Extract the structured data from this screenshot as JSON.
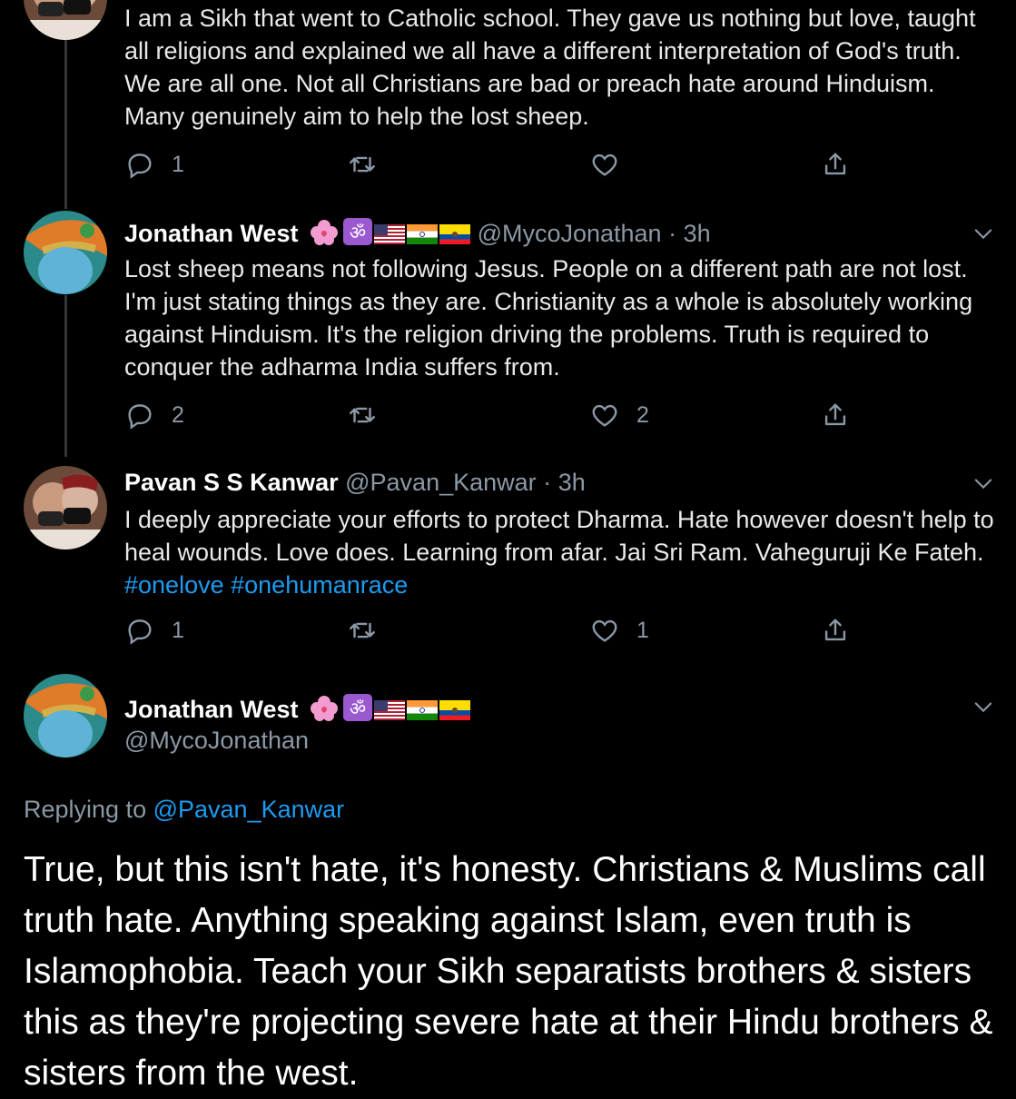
{
  "tweets": [
    {
      "text": "I am a Sikh that went to Catholic school. They gave us nothing but love, taught all religions and explained we all have a different interpretation of God's truth. We are all one. Not all Christians are bad or preach hate around Hinduism. Many genuinely aim to help the lost sheep.",
      "reply_count": "1",
      "retweet_count": "",
      "like_count": ""
    },
    {
      "name": "Jonathan West",
      "handle": "@MycoJonathan",
      "dot": "·",
      "time": "3h",
      "text": "Lost sheep means not following Jesus. People on a different path are not lost. I'm just stating things as they are. Christianity as a whole is absolutely working against Hinduism. It's the religion driving the problems. Truth is required to conquer the adharma India suffers from.",
      "reply_count": "2",
      "retweet_count": "",
      "like_count": "2"
    },
    {
      "name": "Pavan S S Kanwar",
      "handle": "@Pavan_Kanwar",
      "dot": "·",
      "time": "3h",
      "text": "I deeply appreciate your efforts to protect Dharma. Hate however doesn't help to heal wounds. Love does. Learning from afar. Jai Sri Ram. Vaheguruji Ke Fateh. ",
      "hashtags": [
        "#onelove",
        "#onehumanrace"
      ],
      "reply_count": "1",
      "retweet_count": "",
      "like_count": "1"
    }
  ],
  "main_tweet": {
    "name": "Jonathan West",
    "handle": "@MycoJonathan",
    "replying_label": "Replying to",
    "replying_handle": "@Pavan_Kanwar",
    "text": "True, but this isn't hate, it's honesty. Christians & Muslims call truth hate. Anything speaking against Islam, even truth is Islamophobia. Teach your Sikh separatists brothers & sisters this as they're projecting severe hate at their Hindu brothers & sisters from the west."
  },
  "icons": {
    "reply": "reply-icon",
    "retweet": "retweet-icon",
    "like": "heart-icon",
    "share": "share-icon",
    "more": "chevron-down-icon",
    "name_badges": [
      "hibiscus-icon",
      "om-icon",
      "us-flag-icon",
      "india-flag-icon",
      "ecuador-flag-icon"
    ]
  },
  "colors": {
    "background": "#000000",
    "link": "#1d9bf0",
    "muted": "#8b98a5",
    "text": "#e7e9ea"
  }
}
